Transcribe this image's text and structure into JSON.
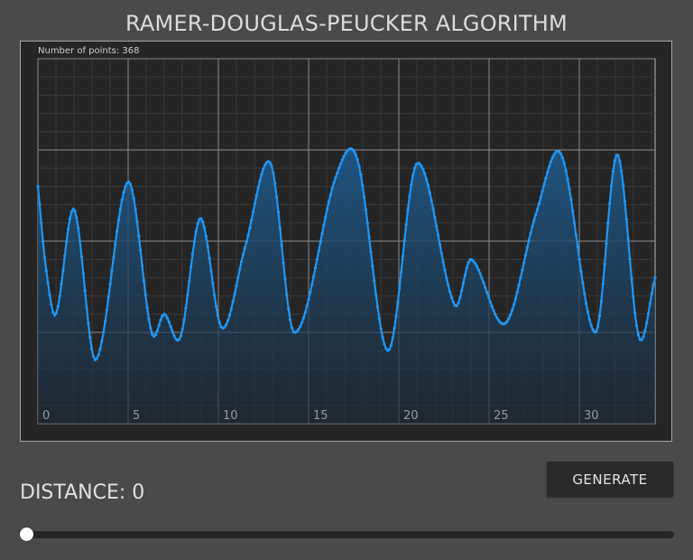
{
  "app": {
    "title": "RAMER-DOUGLAS-PEUCKER ALGORITHM"
  },
  "chart": {
    "point_count_label": "Number of points: 368"
  },
  "controls": {
    "distance_label": "DISTANCE: 0",
    "generate_label": "GENERATE",
    "distance_value": 0
  },
  "colors": {
    "background": "#4a4a4a",
    "panel": "#252525",
    "line": "#2196f3",
    "fill_top": "#1e5a8c",
    "grid_major": "#8a8a8a",
    "grid_minor": "#3a3a3a"
  },
  "chart_data": {
    "type": "area",
    "title": "",
    "xlabel": "",
    "ylabel": "",
    "xlim": [
      0,
      34.2
    ],
    "ylim": [
      -1.0,
      3.0
    ],
    "x_ticks": [
      0,
      5,
      10,
      15,
      20,
      25,
      30
    ],
    "x_tick_labels": [
      "0",
      "5",
      "10",
      "15",
      "20",
      "25",
      "30"
    ],
    "y_grid": [
      -1.0,
      0.0,
      1.0,
      2.0,
      3.0
    ],
    "grid": true,
    "num_points": 368,
    "series": [
      {
        "keypoints": [
          [
            0.0,
            1.6
          ],
          [
            0.45,
            0.7
          ],
          [
            1.0,
            0.2
          ],
          [
            2.0,
            1.35
          ],
          [
            3.2,
            -0.3
          ],
          [
            5.0,
            1.65
          ],
          [
            6.3,
            0.0
          ],
          [
            7.0,
            0.2
          ],
          [
            7.9,
            -0.05
          ],
          [
            9.0,
            1.25
          ],
          [
            10.2,
            0.05
          ],
          [
            11.5,
            0.95
          ],
          [
            12.9,
            1.85
          ],
          [
            14.2,
            0.0
          ],
          [
            16.5,
            1.7
          ],
          [
            17.7,
            1.9
          ],
          [
            19.4,
            -0.2
          ],
          [
            21.0,
            1.85
          ],
          [
            23.1,
            0.3
          ],
          [
            24.0,
            0.8
          ],
          [
            25.9,
            0.1
          ],
          [
            27.6,
            1.3
          ],
          [
            29.0,
            1.95
          ],
          [
            30.9,
            0.0
          ],
          [
            32.1,
            1.95
          ],
          [
            33.3,
            -0.05
          ],
          [
            34.2,
            0.6
          ]
        ]
      }
    ]
  }
}
